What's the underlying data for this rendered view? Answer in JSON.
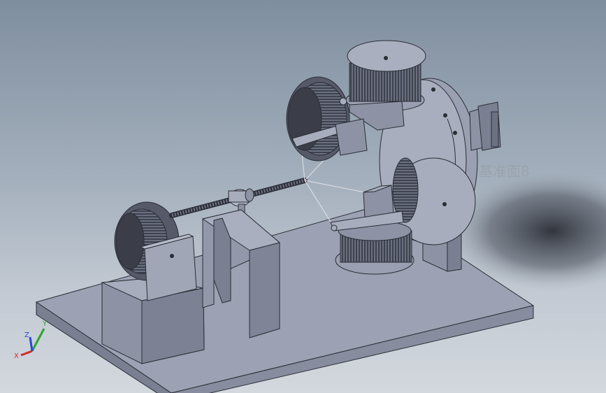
{
  "viewport": {
    "plane_label": "基准面8"
  },
  "triad": {
    "x_label": "X",
    "y_label": "Y",
    "z_label": "Z",
    "x_color": "#d42a2a",
    "y_color": "#2fa52f",
    "z_color": "#2a47d4"
  },
  "colors": {
    "part_light": "#a7adbd",
    "part_mid": "#8d93a4",
    "part_dark": "#6c7183",
    "coil_dark": "#3b3e48",
    "edge": "#2b2d35"
  }
}
